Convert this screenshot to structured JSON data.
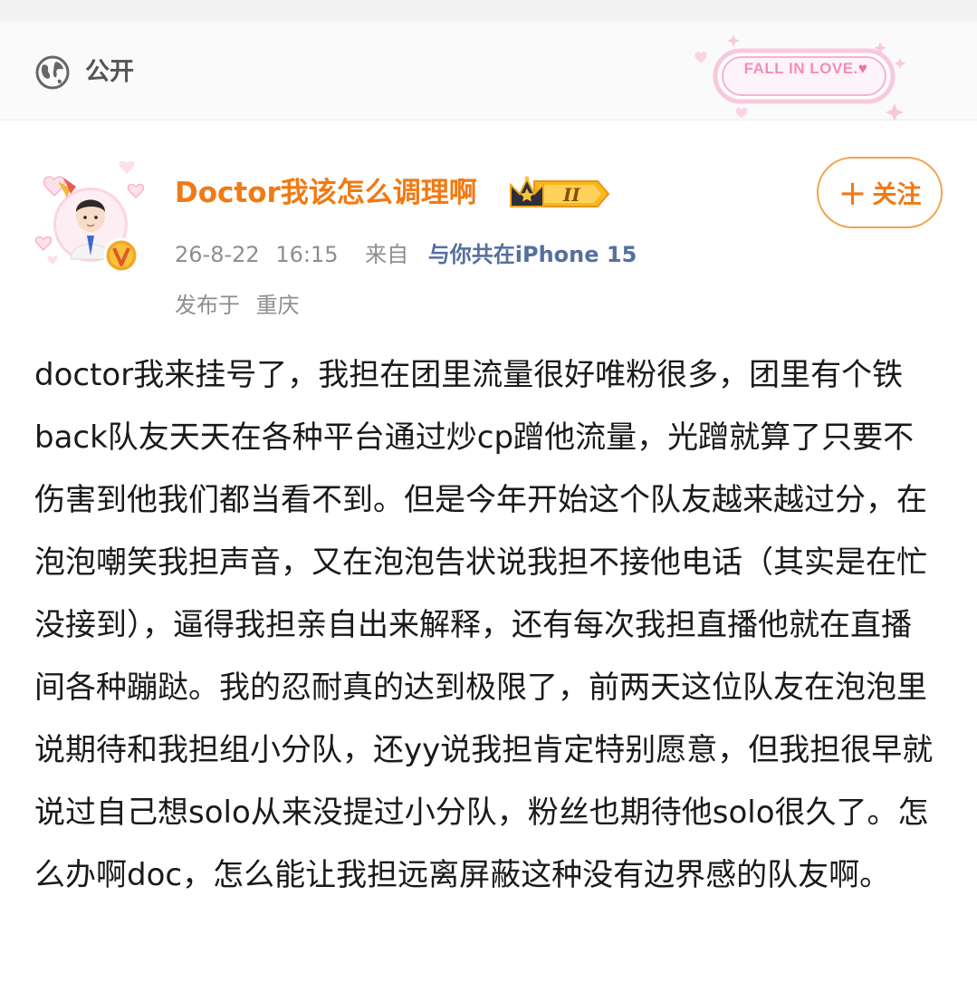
{
  "visibility": {
    "label": "公开",
    "icon": "globe-icon"
  },
  "sticker": {
    "text": "FALL IN LOVE.",
    "icon": "heart-icon"
  },
  "post": {
    "author": "Doctor我该怎么调理啊",
    "badge": {
      "icon": "crown-icon",
      "level": "II"
    },
    "verified_icon": "verified-v-icon",
    "date": "26-8-22",
    "time": "16:15",
    "source_label": "来自",
    "source": "与你共在iPhone 15",
    "location_label": "发布于",
    "location": "重庆",
    "follow_label": "关注",
    "body": "doctor我来挂号了，我担在团里流量很好唯粉很多，团里有个铁back队友天天在各种平台通过炒cp蹭他流量，光蹭就算了只要不伤害到他我们都当看不到。但是今年开始这个队友越来越过分，在泡泡嘲笑我担声音，又在泡泡告状说我担不接他电话（其实是在忙没接到），逼得我担亲自出来解释，还有每次我担直播他就在直播间各种蹦跶。我的忍耐真的达到极限了，前两天这位队友在泡泡里说期待和我担组小分队，还yy说我担肯定特别愿意，但我担很早就说过自己想solo从来没提过小分队，粉丝也期待他solo很久了。怎么办啊doc，怎么能让我担远离屏蔽这种没有边界感的队友啊。"
  },
  "colors": {
    "accent_orange": "#f07a14",
    "source_blue": "#55709e",
    "meta_gray": "#8e8e8e"
  }
}
